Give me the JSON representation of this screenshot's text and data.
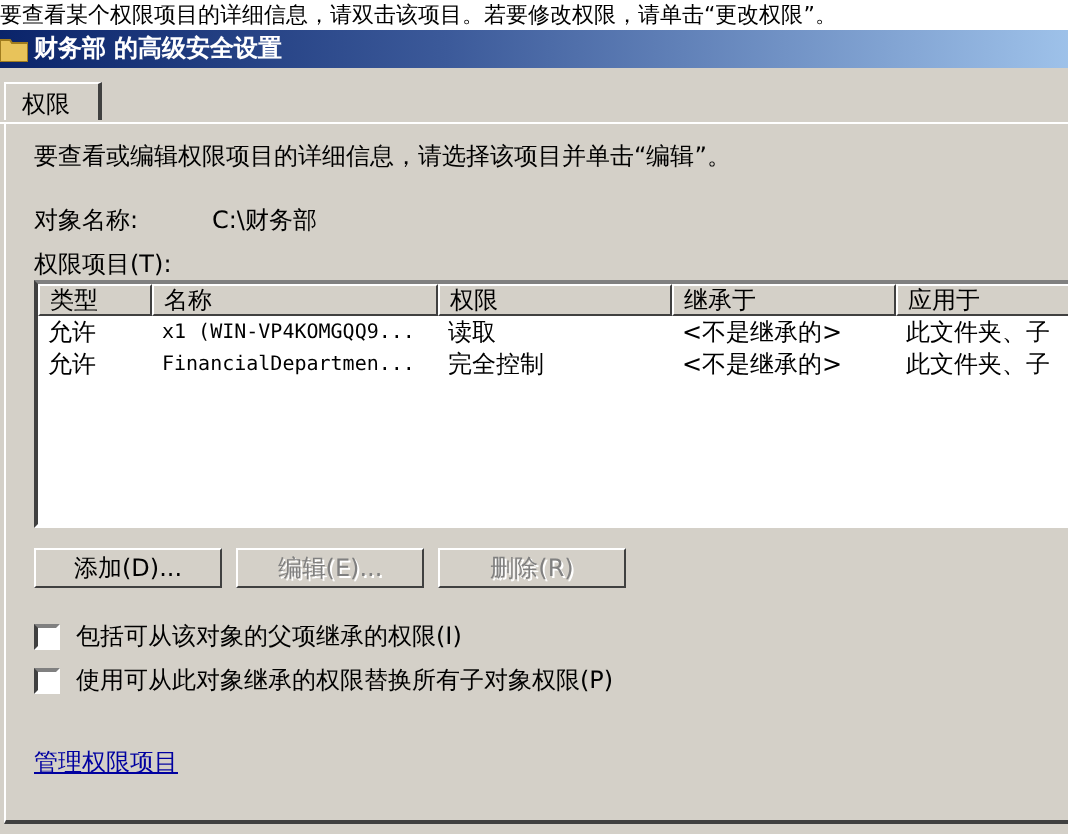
{
  "background_window": {
    "text": "要查看某个权限项目的详细信息，请双击该项目。若要修改权限，请单击“更改权限”。"
  },
  "window": {
    "title": "财务部 的高级安全设置"
  },
  "tabs": [
    {
      "label": "权限",
      "selected": true
    }
  ],
  "description": "要查看或编辑权限项目的详细信息，请选择该项目并单击“编辑”。",
  "object_name": {
    "label": "对象名称:",
    "value": "C:\\财务部"
  },
  "permission_list": {
    "label": "权限项目(T):",
    "columns": [
      "类型",
      "名称",
      "权限",
      "继承于",
      "应用于"
    ],
    "rows": [
      {
        "cells": [
          "允许",
          "x1 (WIN-VP4KOMGQQ9...",
          "读取",
          "<不是继承的>",
          "此文件夹、子"
        ],
        "selected": false
      },
      {
        "cells": [
          "允许",
          "FinancialDepartmen...",
          "完全控制",
          "<不是继承的>",
          "此文件夹、子"
        ],
        "selected": false
      }
    ]
  },
  "buttons": [
    {
      "label": "添加(D)...",
      "disabled": false
    },
    {
      "label": "编辑(E)...",
      "disabled": true
    },
    {
      "label": "删除(R)",
      "disabled": true
    }
  ],
  "checkboxes": [
    {
      "label": "包括可从该对象的父项继承的权限(I)",
      "checked": false
    },
    {
      "label": "使用可从此对象继承的权限替换所有子对象权限(P)",
      "checked": false
    }
  ],
  "link": "管理权限项目"
}
